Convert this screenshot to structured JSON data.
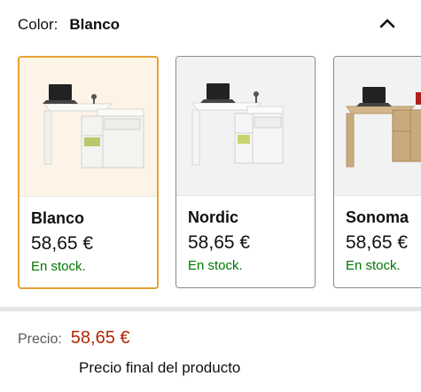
{
  "color_selector": {
    "label": "Color:",
    "selected_value": "Blanco",
    "collapse_icon": "chevron-up-icon"
  },
  "swatches": [
    {
      "name": "Blanco",
      "price": "58,65 €",
      "stock": "En stock.",
      "selected": true,
      "desk_color": "#f3f3f0"
    },
    {
      "name": "Nordic",
      "price": "58,65 €",
      "stock": "En stock.",
      "selected": false,
      "desk_color": "#f6f6f6"
    },
    {
      "name": "Sonoma",
      "price": "58,65 €",
      "stock": "En stock.",
      "selected": false,
      "desk_color": "#c9a97e"
    }
  ],
  "price": {
    "label": "Precio:",
    "value": "58,65 €",
    "note": "Precio final del producto"
  },
  "colors": {
    "accent_border": "#e7a234",
    "stock_green": "#007600",
    "price_red": "#b12704"
  }
}
